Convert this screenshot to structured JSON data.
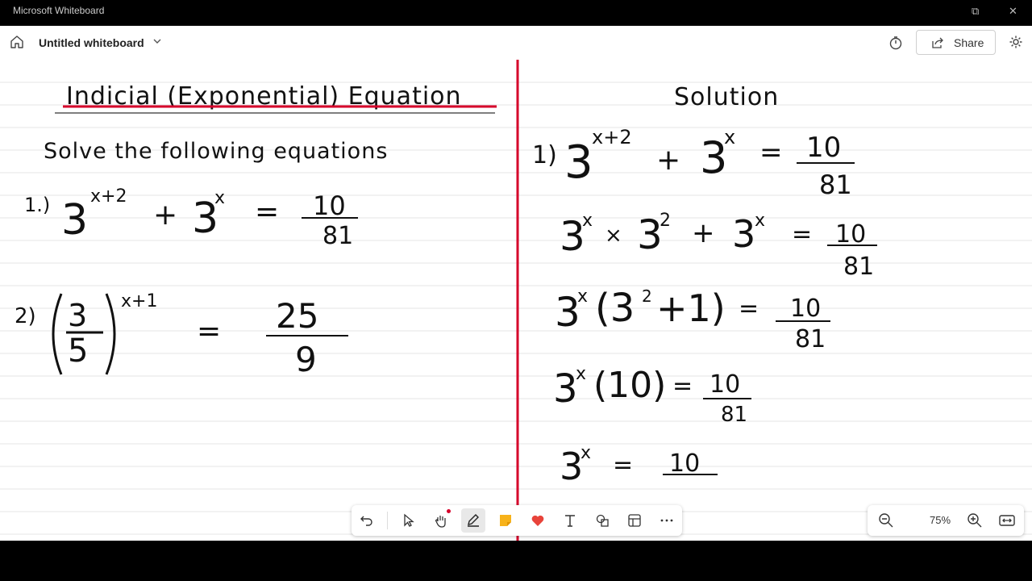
{
  "window": {
    "title": "Microsoft Whiteboard"
  },
  "appbar": {
    "title": "Untitled whiteboard",
    "share_label": "Share"
  },
  "board": {
    "left": {
      "heading": "Indicial (Exponential) Equation",
      "instruction": "Solve the following equations",
      "q1": {
        "number": "1.)",
        "base": "3",
        "exp1": "x+2",
        "plus": "+",
        "exp2": "x",
        "equals": "=",
        "num": "10",
        "den": "81"
      },
      "q2": {
        "number": "2)",
        "frac_num": "3",
        "frac_den": "5",
        "exp": "x+1",
        "equals": "=",
        "num": "25",
        "den": "9"
      }
    },
    "right": {
      "heading": "Solution",
      "step1": {
        "number": "1)",
        "exp1": "x+2",
        "exp2": "x",
        "num": "10",
        "den": "81"
      },
      "step2": {
        "text_a": "3",
        "exp_a": "x",
        "times": "×",
        "text_b": "3",
        "exp_b": "2",
        "plus": "+",
        "text_c": "3",
        "exp_c": "x",
        "num": "10",
        "den": "81"
      },
      "step3": {
        "lhs": "3",
        "exp": "x",
        "paren": "(3",
        "paren_exp": "2",
        "paren_rest": "+1)",
        "num": "10",
        "den": "81"
      },
      "step4": {
        "lhs": "3",
        "exp": "x",
        "paren": "(10)",
        "num": "10",
        "den": "81"
      },
      "step5": {
        "lhs": "3",
        "exp": "x",
        "num": "10"
      }
    }
  },
  "toolbar": {
    "tools": [
      "undo-icon",
      "select-icon",
      "hand-icon",
      "pen-icon",
      "sticky-note-icon",
      "reaction-heart-icon",
      "text-icon",
      "shapes-icon",
      "template-icon",
      "more-icon"
    ]
  },
  "zoom": {
    "value": "75%"
  },
  "colors": {
    "margin_line": "#d6002a",
    "rule_line": "#e3e3e3",
    "ink": "#111111",
    "heading_underline": "#d6002a"
  }
}
